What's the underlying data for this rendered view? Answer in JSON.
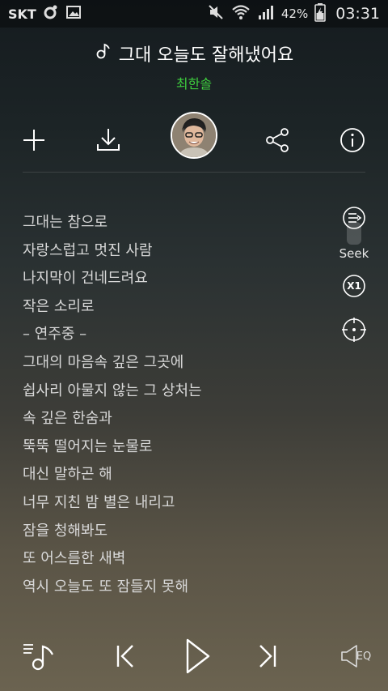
{
  "statusbar": {
    "carrier": "SKT",
    "battery_percent": "42%",
    "time": "03:31"
  },
  "song": {
    "title": "그대 오늘도 잘해냈어요",
    "artist": "최한솔"
  },
  "actions": {
    "icons": [
      "plus-icon",
      "download-icon",
      "artist-avatar",
      "share-icon",
      "info-icon"
    ]
  },
  "lyrics": [
    "그대는 참으로",
    "자랑스럽고 멋진 사람",
    "나지막이 건네드려요",
    "작은 소리로",
    "– 연주중 –",
    "그대의 마음속 깊은 그곳에",
    "쉽사리 아물지 않는 그 상처는",
    "속 깊은 한숨과",
    "뚝뚝 떨어지는 눈물로",
    "대신 말하곤 해",
    "너무 지친 밤 별은 내리고",
    "잠을 청해봐도",
    "또 어스름한 새벽",
    "역시 오늘도 또 잠들지 못해"
  ],
  "side": {
    "seek_label": "Seek",
    "speed_label": "X1"
  },
  "player": {
    "eq_label": "EQ"
  },
  "colors": {
    "artist": "#3ecf3e",
    "text": "#ffffff",
    "lyric": "#d8d8d8"
  }
}
